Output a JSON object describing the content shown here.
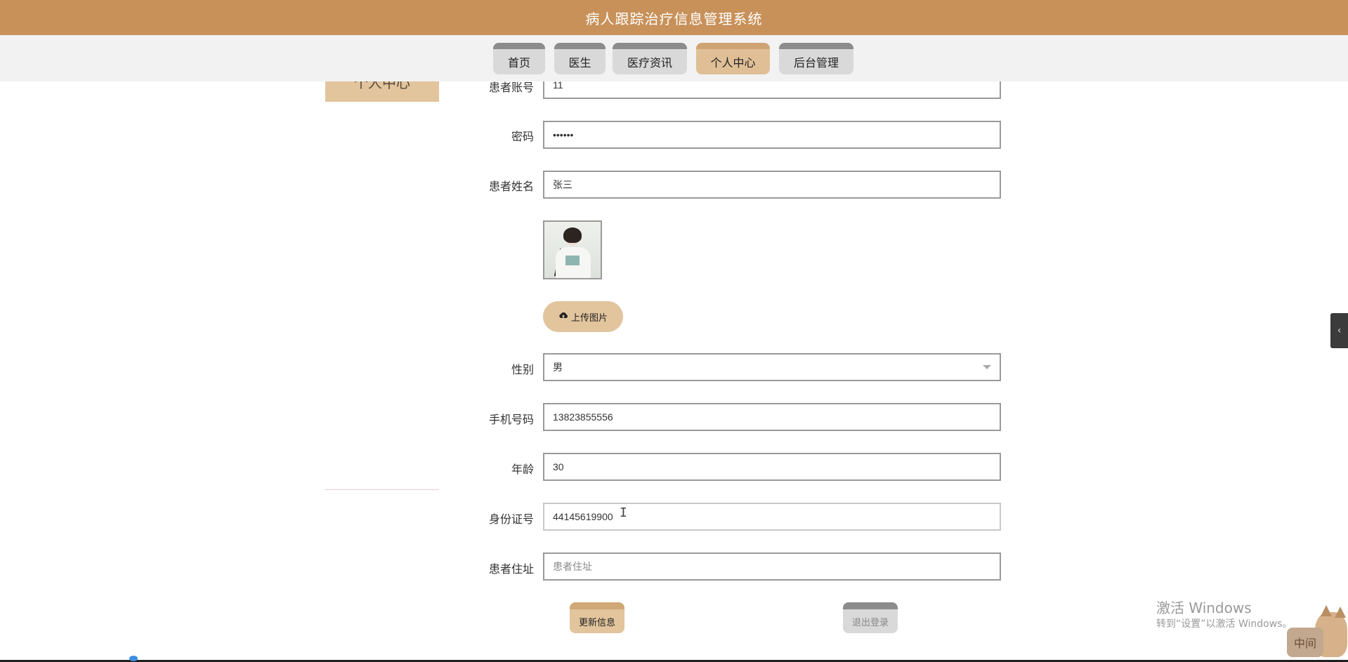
{
  "app": {
    "title": "病人跟踪治疗信息管理系统"
  },
  "nav": {
    "tabs": [
      {
        "label": "首页"
      },
      {
        "label": "医生"
      },
      {
        "label": "医疗资讯"
      },
      {
        "label": "个人中心",
        "active": true
      },
      {
        "label": "后台管理"
      }
    ]
  },
  "sidebar": {
    "title": "个人中心"
  },
  "form": {
    "account": {
      "label": "患者账号",
      "value": "11"
    },
    "password": {
      "label": "密码",
      "value": "••••••"
    },
    "name": {
      "label": "患者姓名",
      "value": "张三"
    },
    "avatar": {
      "icon": "user-photo"
    },
    "upload": {
      "label": "上传图片",
      "icon": "cloud-upload-icon"
    },
    "gender": {
      "label": "性别",
      "value": "男"
    },
    "phone": {
      "label": "手机号码",
      "value": "13823855556"
    },
    "age": {
      "label": "年龄",
      "value": "30"
    },
    "id_card": {
      "label": "身份证号",
      "value": "44145619900"
    },
    "address": {
      "label": "患者住址",
      "placeholder": "患者住址"
    }
  },
  "actions": {
    "update": "更新信息",
    "logout": "退出登录"
  },
  "watermark": {
    "title": "激活 Windows",
    "subtitle": "转到“设置”以激活 Windows。"
  },
  "mascot": {
    "badge": "中间"
  },
  "colors": {
    "header": "#c8915a",
    "accent": "#e2c49d",
    "tab_inactive": "#d9d9d9"
  }
}
